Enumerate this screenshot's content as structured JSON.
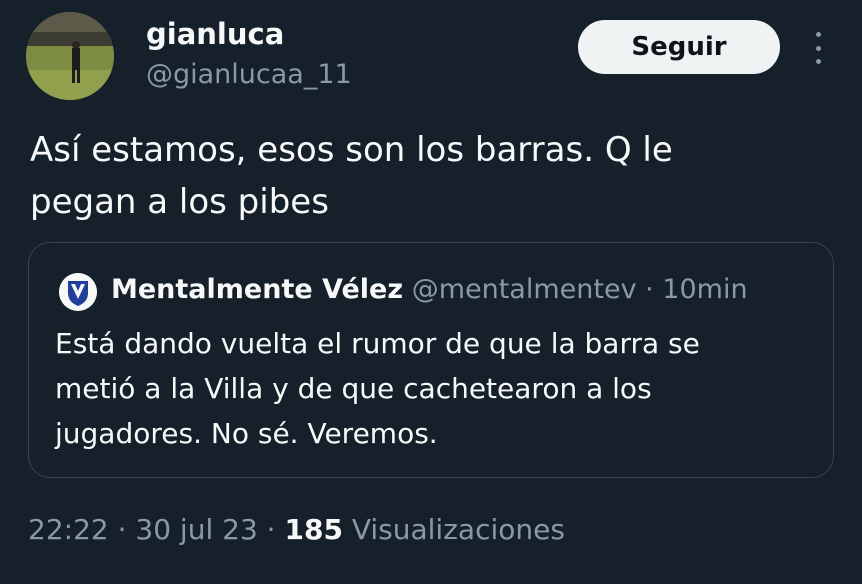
{
  "author": {
    "name": "gianluca",
    "handle": "@gianlucaa_11"
  },
  "follow_button": {
    "label": "Seguir"
  },
  "more_icon": "more-vertical-icon",
  "tweet": {
    "text_line1": "Así estamos, esos son los barras. Q le",
    "text_line2": "pegan a los pibes"
  },
  "quoted_tweet": {
    "author_name": "Mentalmente Vélez",
    "author_handle": "@mentalmentev",
    "separator": " · ",
    "time": "10min",
    "text_line1": "Está dando vuelta el rumor de que la barra se",
    "text_line2": "metió a la Villa  y de que cachetearon a los",
    "text_line3": "jugadores. No sé. Veremos."
  },
  "footer": {
    "time": "22:22",
    "separator": " · ",
    "date": "30 jul 23",
    "views_count": "185",
    "views_label": "Visualizaciones"
  },
  "colors": {
    "background": "#15202b",
    "text_primary": "#f7f9f9",
    "text_secondary": "#8b98a5",
    "border": "#38444d",
    "button_bg": "#eff3f4"
  }
}
